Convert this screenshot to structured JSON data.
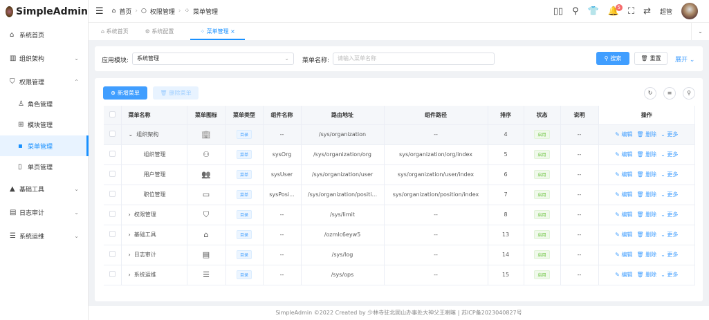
{
  "app": {
    "title": "SimpleAdmin"
  },
  "sidebar": {
    "items": [
      {
        "label": "系统首页",
        "icon": "home-icon",
        "glyph": "⌂"
      },
      {
        "label": "组织架构",
        "icon": "building-icon",
        "glyph": "▥",
        "chev": "⌄"
      },
      {
        "label": "权限管理",
        "icon": "shield-icon",
        "glyph": "⛉",
        "chev": "⌃"
      },
      {
        "label": "角色管理",
        "icon": "user-icon",
        "glyph": "♙",
        "sub": true
      },
      {
        "label": "模块管理",
        "icon": "grid-icon",
        "glyph": "⊞",
        "sub": true
      },
      {
        "label": "菜单管理",
        "icon": "grid-icon",
        "glyph": "▪",
        "sub": true,
        "active": true
      },
      {
        "label": "单页管理",
        "icon": "book-icon",
        "glyph": "▯",
        "sub": true
      },
      {
        "label": "基础工具",
        "icon": "house-icon",
        "glyph": "▲",
        "chev": "⌄"
      },
      {
        "label": "日志审计",
        "icon": "document-icon",
        "glyph": "▤",
        "chev": "⌄"
      },
      {
        "label": "系统运维",
        "icon": "server-icon",
        "glyph": "☰",
        "chev": "⌄"
      }
    ]
  },
  "header": {
    "breadcrumb": [
      "首页",
      "权限管理",
      "菜单管理"
    ],
    "user": "超管",
    "notification_count": "5"
  },
  "tabs": [
    {
      "label": "系统首页"
    },
    {
      "label": "系统配置"
    },
    {
      "label": "菜单管理",
      "active": true
    }
  ],
  "search": {
    "module_label": "应用模块:",
    "module_value": "系统管理",
    "name_label": "菜单名称:",
    "name_placeholder": "请输入菜单名称",
    "search_btn": "搜索",
    "reset_btn": "重置",
    "expand": "展开"
  },
  "toolbar": {
    "add": "新增菜单",
    "delete": "删除菜单"
  },
  "table": {
    "headers": [
      "菜单名称",
      "菜单图标",
      "菜单类型",
      "组件名称",
      "路由地址",
      "组件路径",
      "排序",
      "状态",
      "说明",
      "操作"
    ],
    "actions": {
      "edit": "编辑",
      "delete": "删除",
      "more": "更多"
    },
    "rows": [
      {
        "name": "组织架构",
        "expand": "⌄",
        "icon": "🏢",
        "type": "目录",
        "comp": "--",
        "route": "/sys/organization",
        "path": "--",
        "sort": "4",
        "status": "启用",
        "desc": "--",
        "hl": true
      },
      {
        "name": "组织管理",
        "child": true,
        "icon": "⚇",
        "type": "菜单",
        "comp": "sysOrg",
        "route": "/sys/organization/org",
        "path": "sys/organization/org/index",
        "sort": "5",
        "status": "启用",
        "desc": "--"
      },
      {
        "name": "用户管理",
        "child": true,
        "icon": "👥",
        "type": "菜单",
        "comp": "sysUser",
        "route": "/sys/organization/user",
        "path": "sys/organization/user/index",
        "sort": "6",
        "status": "启用",
        "desc": "--"
      },
      {
        "name": "职位管理",
        "child": true,
        "icon": "▭",
        "type": "菜单",
        "comp": "sysPosi...",
        "route": "/sys/organization/positi...",
        "path": "sys/organization/position/index",
        "sort": "7",
        "status": "启用",
        "desc": "--"
      },
      {
        "name": "权限管理",
        "expand": "›",
        "icon": "⛉",
        "type": "目录",
        "comp": "--",
        "route": "/sys/limit",
        "path": "--",
        "sort": "8",
        "status": "启用",
        "desc": "--"
      },
      {
        "name": "基础工具",
        "expand": "›",
        "icon": "⌂",
        "type": "目录",
        "comp": "--",
        "route": "/ozmlc6eyw5",
        "path": "--",
        "sort": "13",
        "status": "启用",
        "desc": "--"
      },
      {
        "name": "日志审计",
        "expand": "›",
        "icon": "▤",
        "type": "目录",
        "comp": "--",
        "route": "/sys/log",
        "path": "--",
        "sort": "14",
        "status": "启用",
        "desc": "--"
      },
      {
        "name": "系统运维",
        "expand": "›",
        "icon": "☰",
        "type": "目录",
        "comp": "--",
        "route": "/sys/ops",
        "path": "--",
        "sort": "15",
        "status": "启用",
        "desc": "--"
      }
    ]
  },
  "footer": "SimpleAdmin ©2022 Created by 少林寺驻北固山办事处大神父王喇嘛 | 苏ICP备2023040827号"
}
